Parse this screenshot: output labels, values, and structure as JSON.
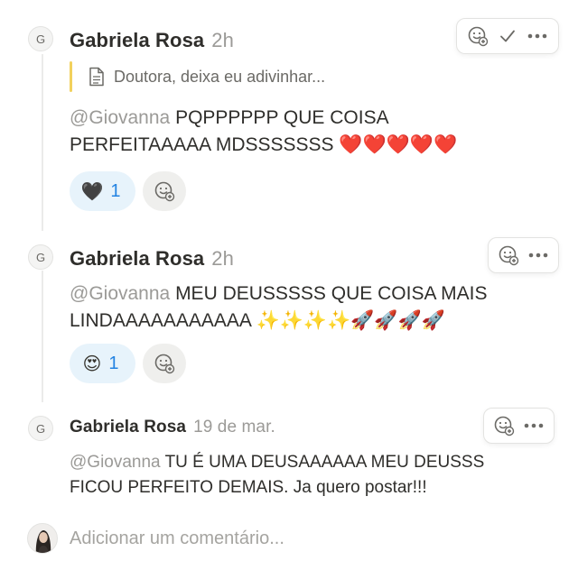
{
  "comments": [
    {
      "avatar_initial": "G",
      "author": "Gabriela Rosa",
      "time": "2h",
      "quote": "Doutora, deixa eu adivinhar...",
      "mention": "@Giovanna",
      "line1": "PQPPPPPP QUE COISA",
      "line2_text": "PERFEITAAAAA MDSSSSSSS",
      "line2_emoji": "❤️❤️❤️❤️❤️",
      "reaction_emoji": "🖤",
      "reaction_count": "1"
    },
    {
      "avatar_initial": "G",
      "author": "Gabriela Rosa",
      "time": "2h",
      "mention": "@Giovanna",
      "line1": "MEU DEUSSSSS QUE COISA MAIS",
      "line2_text": "LINDAAAAAAAAAAA",
      "line2_emoji": "✨✨✨✨🚀🚀🚀🚀",
      "reaction_emoji": "😍",
      "reaction_count": "1"
    },
    {
      "avatar_initial": "G",
      "author": "Gabriela Rosa",
      "time": "19 de mar.",
      "mention": "@Giovanna",
      "line1": "TU É UMA DEUSAAAAAA MEU DEUSSS",
      "line2_text": "FICOU PERFEITO DEMAIS. Ja quero postar!!!"
    }
  ],
  "toolbar": {
    "more_glyph": "•••",
    "resolve_glyph": "✓"
  },
  "reply": {
    "placeholder": "Adicionar um comentário..."
  },
  "colors": {
    "mention": "#9b9a97",
    "reaction_bg": "#e7f3fb",
    "quote_bar": "#f2d15c"
  }
}
